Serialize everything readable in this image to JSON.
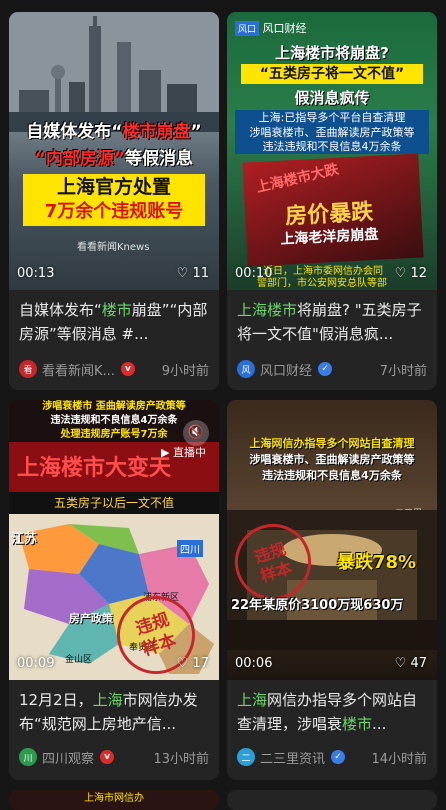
{
  "cards": [
    {
      "duration": "00:13",
      "likes": "11",
      "title_parts": [
        "自媒体发布“",
        "楼市",
        "崩盘”“内部房源”等假消息 #..."
      ],
      "author": "看看新闻K...",
      "time": "9小时前",
      "thumb": {
        "line1a": "自媒体发布“",
        "line1b": "楼市崩盘",
        "line1c": "”",
        "line2a": "“内部房源”",
        "line2b": "等假消息",
        "line3": "上海官方处置",
        "line4": "7万余个违规账号",
        "watermark": "看看新闻Knews"
      }
    },
    {
      "duration": "00:10",
      "likes": "12",
      "title_parts": [
        "",
        "上海楼市",
        "将崩盘? \"五类房子将一文不值\"假消息疯..."
      ],
      "author": "风口财经",
      "time": "7小时前",
      "thumb": {
        "logo": "风口财经",
        "h1": "上海楼市将崩盘?",
        "h2": "“五类房子将一文不值”",
        "h3": "假消息疯传",
        "b1": "上海:已指导多个平台自查清理",
        "b2": "涉唱衰楼市、歪曲解读房产政策等",
        "b3": "违法违规和不良信息4万余条",
        "stamp_text": "上海楼市大跌",
        "fake1": "房价暴跌",
        "fake2": "上海老洋房崩盘",
        "foot1": "近日，上海市委网信办会同",
        "foot2": "警部门，市公安网安总队等部"
      }
    },
    {
      "duration": "00:09",
      "likes": "17",
      "title_parts": [
        "12月2日，",
        "上海",
        "市网信办发布“规范网上房地产信..."
      ],
      "author": "四川观察",
      "time": "13小时前",
      "thumb": {
        "t1": "涉唱衰楼市 歪曲解读房产政策等",
        "t2": "违法违规和不良信息4万余条",
        "t3": "处理违规房产账号7万余",
        "live": "直播中",
        "big": "上海楼市大变天",
        "sub": "五类房子以后一文不值",
        "m1": "江苏",
        "m2": "四川",
        "m3": "房产政策",
        "m4": "违规",
        "m5": "浦东新区",
        "m6": "金山区",
        "m7": "奉贤区",
        "stamp1": "违规",
        "stamp2": "样本"
      }
    },
    {
      "duration": "00:06",
      "likes": "47",
      "title_parts": [
        "",
        "上海",
        "网信办指导多个网站自查清理，涉唱衰",
        "楼市",
        "..."
      ],
      "author": "二三里资讯",
      "time": "14小时前",
      "thumb": {
        "h1": "上海网信办指导多个网站自查清理",
        "h2": "涉唱衰楼市、歪曲解读房产政策等",
        "h3": "违法违规和不良信息4万余条",
        "stamp1": "违规",
        "stamp2": "样本",
        "badge": "暴跌78%",
        "caption": "22年某原价3100万现630万",
        "corner": "二三里"
      }
    }
  ],
  "bottom_peek": "上海市网信办"
}
